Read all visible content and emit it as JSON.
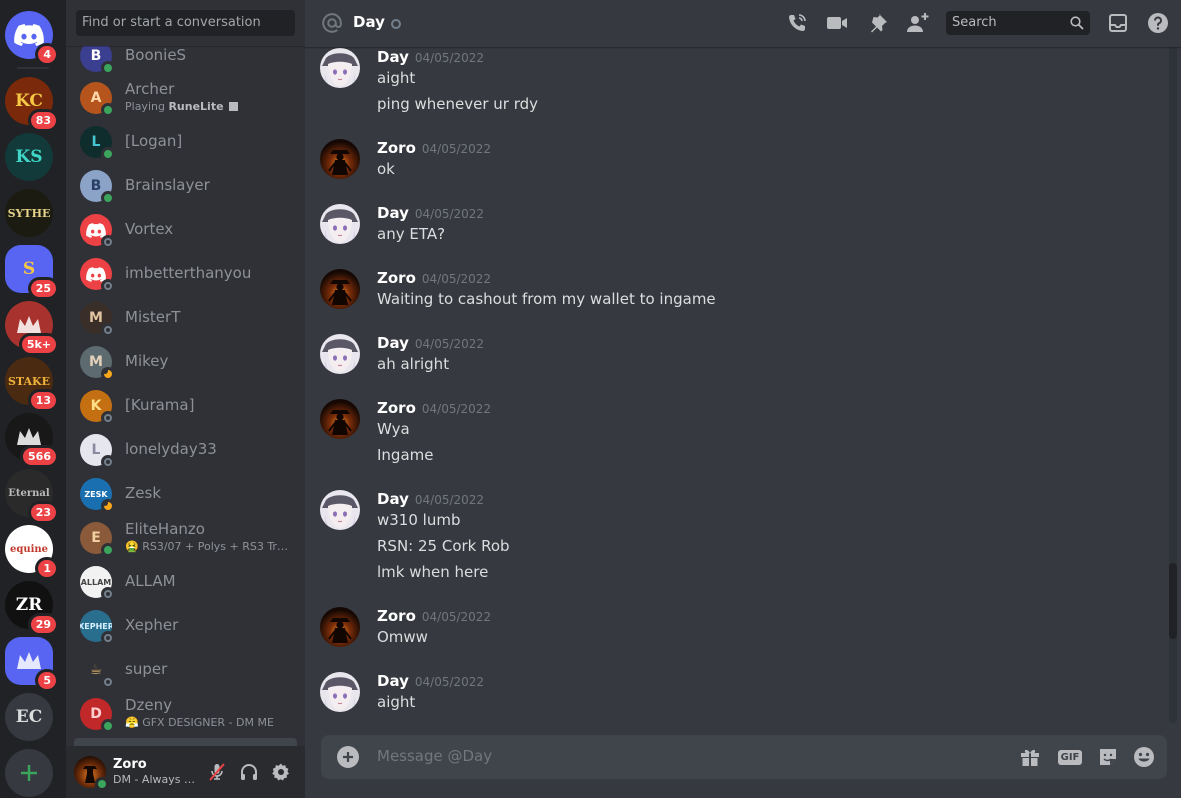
{
  "servers": [
    {
      "name": "home",
      "badge": "4",
      "kind": "home"
    },
    {
      "name": "kc",
      "badge": "83",
      "initials": "KC",
      "bg": "#7a2a0a",
      "fg": "#f6c744"
    },
    {
      "name": "king-of-stakes",
      "badge": "",
      "initials": "KS",
      "bg": "#123a3a",
      "fg": "#3fd6c8"
    },
    {
      "name": "sythe",
      "badge": "",
      "initials": "SYTHE",
      "bg": "#1b1b12",
      "fg": "#e7d38a"
    },
    {
      "name": "s-server",
      "badge": "25",
      "initials": "S",
      "bg": "#5865f2",
      "fg": "#f6c744"
    },
    {
      "name": "crown-server",
      "badge": "5k+",
      "initials": "",
      "bg": "#a8322d",
      "fg": "#ffffff"
    },
    {
      "name": "stake-server",
      "badge": "13",
      "initials": "STAKE",
      "bg": "#4a2a10",
      "fg": "#f0b23a"
    },
    {
      "name": "ninja-server",
      "badge": "566",
      "initials": "",
      "bg": "#181818",
      "fg": "#ffffff"
    },
    {
      "name": "eternal",
      "badge": "23",
      "initials": "Eternal",
      "bg": "#2a2a2a",
      "fg": "#bbbbbb"
    },
    {
      "name": "equine",
      "badge": "1",
      "initials": "equine",
      "bg": "#ffffff",
      "fg": "#c0392b"
    },
    {
      "name": "zr-server",
      "badge": "29",
      "initials": "ZR",
      "bg": "#111111",
      "fg": "#ffffff"
    },
    {
      "name": "purple-server",
      "badge": "5",
      "initials": "",
      "bg": "#5865f2",
      "fg": "#ffffff"
    },
    {
      "name": "ec-server",
      "badge": "",
      "initials": "EC",
      "bg": "#36393f",
      "fg": "#dcddde"
    },
    {
      "name": "add-server",
      "badge": "",
      "kind": "add"
    }
  ],
  "dm_search": {
    "placeholder": "Find or start a conversation"
  },
  "dms": [
    {
      "name": "BoonieS",
      "sub": "",
      "status": "online",
      "bg": "#3b3f8f",
      "fg": "#ffffff",
      "glyph": "B"
    },
    {
      "name": "Archer",
      "sub_prefix": "Playing ",
      "sub_bold": "RuneLite",
      "status": "online",
      "bg": "#b5541c",
      "fg": "#ffd7a8",
      "glyph": "A"
    },
    {
      "name": "[Logan]",
      "sub": "",
      "status": "online",
      "bg": "#0f2d2d",
      "fg": "#45c5d0",
      "glyph": "L"
    },
    {
      "name": "Brainslayer",
      "sub": "",
      "status": "online",
      "bg": "#8aa3c6",
      "fg": "#2a3e66",
      "glyph": "B"
    },
    {
      "name": "Vortex",
      "sub": "",
      "status": "offline",
      "bg": "#ed4245",
      "fg": "#ffffff",
      "glyph": "discord"
    },
    {
      "name": "imbetterthanyou",
      "sub": "",
      "status": "offline",
      "bg": "#ed4245",
      "fg": "#ffffff",
      "glyph": "discord"
    },
    {
      "name": "MisterT",
      "sub": "",
      "status": "offline",
      "bg": "#3a2e28",
      "fg": "#e2c3a0",
      "glyph": "M"
    },
    {
      "name": "Mikey",
      "sub": "",
      "status": "idle",
      "bg": "#5d6a70",
      "fg": "#e5d0b8",
      "glyph": "M"
    },
    {
      "name": "[Kurama]",
      "sub": "",
      "status": "offline",
      "bg": "#c36f12",
      "fg": "#ffe08a",
      "glyph": "K"
    },
    {
      "name": "lonelyday33",
      "sub": "",
      "status": "offline",
      "bg": "#e6e6ee",
      "fg": "#8a8aa0",
      "glyph": "L"
    },
    {
      "name": "Zesk",
      "sub": "",
      "status": "idle",
      "bg": "#1a6fb0",
      "fg": "#ffffff",
      "glyph": "ZESK"
    },
    {
      "name": "EliteHanzo",
      "sub": "🤮 RS3/07 + Polys + RS3 Trai...",
      "status": "online",
      "bg": "#8a5a3a",
      "fg": "#f0d0a0",
      "glyph": "E"
    },
    {
      "name": "ALLAM",
      "sub": "",
      "status": "offline",
      "bg": "#f2f2f2",
      "fg": "#444444",
      "glyph": "ALLAM"
    },
    {
      "name": "Xepher",
      "sub": "",
      "status": "offline",
      "bg": "#2a6e8e",
      "fg": "#d4f0ff",
      "glyph": "XEPHER"
    },
    {
      "name": "super",
      "sub": "",
      "status": "offline",
      "bg": "#2f3136",
      "fg": "#c8a060",
      "glyph": "☕"
    },
    {
      "name": "Dzeny",
      "sub": "😤 GFX DESIGNER - DM ME",
      "status": "online",
      "bg": "#c0282a",
      "fg": "#ffd0d0",
      "glyph": "D"
    },
    {
      "name": "",
      "sub": "",
      "status": "none",
      "bg": "#2f3136",
      "fg": "#ffffff",
      "glyph": ""
    }
  ],
  "user": {
    "name": "Zoro",
    "sub": "DM - Always a..."
  },
  "header": {
    "title": "Day",
    "search_placeholder": "Search"
  },
  "messages": [
    {
      "author": "Day",
      "time": "04/05/2022",
      "lines": [
        "aight",
        "ping whenever ur rdy"
      ]
    },
    {
      "author": "Zoro",
      "time": "04/05/2022",
      "lines": [
        "ok"
      ]
    },
    {
      "author": "Day",
      "time": "04/05/2022",
      "lines": [
        "any ETA?"
      ]
    },
    {
      "author": "Zoro",
      "time": "04/05/2022",
      "lines": [
        "Waiting to cashout from my wallet to ingame"
      ]
    },
    {
      "author": "Day",
      "time": "04/05/2022",
      "lines": [
        "ah alright"
      ]
    },
    {
      "author": "Zoro",
      "time": "04/05/2022",
      "lines": [
        "Wya",
        "Ingame"
      ]
    },
    {
      "author": "Day",
      "time": "04/05/2022",
      "lines": [
        "w310 lumb",
        "RSN: 25 Cork Rob",
        "lmk when here"
      ]
    },
    {
      "author": "Zoro",
      "time": "04/05/2022",
      "lines": [
        "Omww"
      ]
    },
    {
      "author": "Day",
      "time": "04/05/2022",
      "lines": [
        "aight"
      ]
    }
  ],
  "composer": {
    "placeholder": "Message @Day",
    "gif_label": "GIF"
  },
  "colors": {
    "accent": "#5865f2",
    "badge": "#ed4245",
    "online": "#3ba55d",
    "idle": "#faa81a",
    "offline": "#747f8d"
  }
}
